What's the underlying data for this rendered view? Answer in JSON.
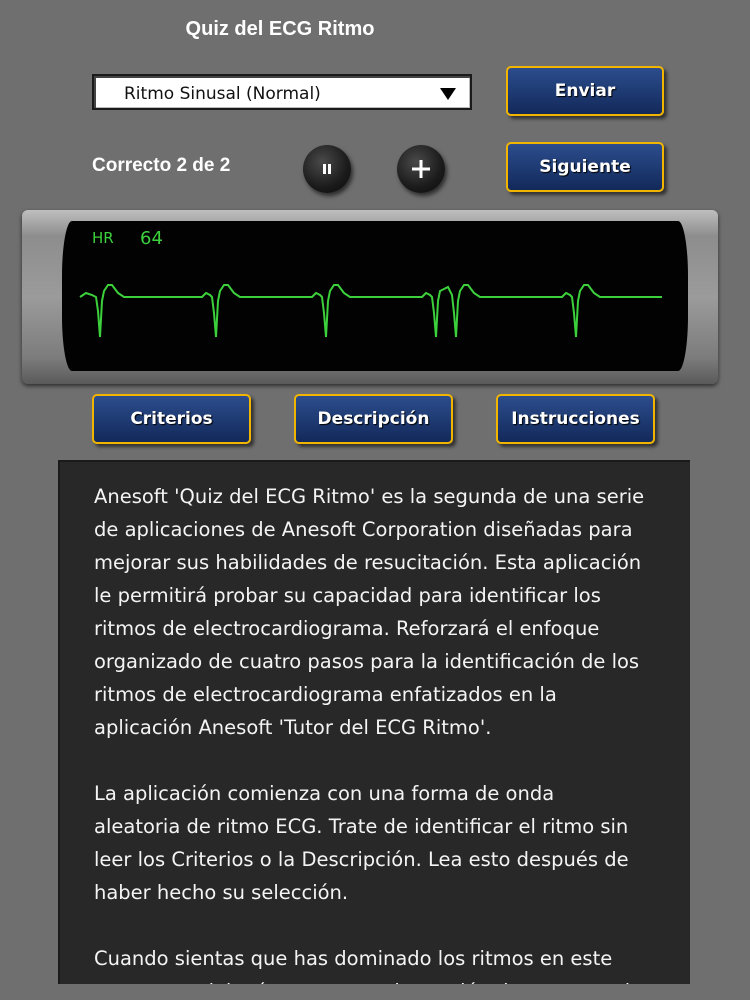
{
  "app": {
    "title": "Quiz del ECG Ritmo"
  },
  "controls": {
    "rhythm_select_value": "Ritmo Sinusal (Normal)",
    "submit_label": "Enviar",
    "next_label": "Siguiente",
    "score_text": "Correcto 2 de 2",
    "pause_icon": "pause-icon",
    "plus_icon": "plus-icon"
  },
  "monitor": {
    "hr_label": "HR",
    "hr_value": "64",
    "trace_color": "#3cd13c"
  },
  "tabs": {
    "criteria_label": "Criterios",
    "description_label": "Descripción",
    "instructions_label": "Instrucciones"
  },
  "description": {
    "paragraphs": [
      "Anesoft 'Quiz del ECG Ritmo' es la segunda de una serie\nde aplicaciones de Anesoft Corporation diseñadas para\nmejorar sus habilidades de resucitación. Esta aplicación\nle permitirá probar su capacidad para identificar los\nritmos de electrocardiograma. Reforzará el enfoque\norganizado de cuatro pasos para la identificación de los\nritmos de electrocardiograma enfatizados en la\naplicación Anesoft 'Tutor del ECG Ritmo'.",
      "La aplicación comienza con una forma de onda\naleatoria de ritmo ECG. Trate de identificar el ritmo sin\nleer los Criterios o la Descripción. Lea esto después de\nhaber hecho su selección.",
      "Cuando sientas que has dominado los ritmos en este\nprograma, deberías avanzar a la gestión de emergencias"
    ]
  },
  "colors": {
    "button_border": "#f1b500",
    "button_fill": "#203d76",
    "background": "#6f6f6f",
    "panel": "#282828"
  }
}
